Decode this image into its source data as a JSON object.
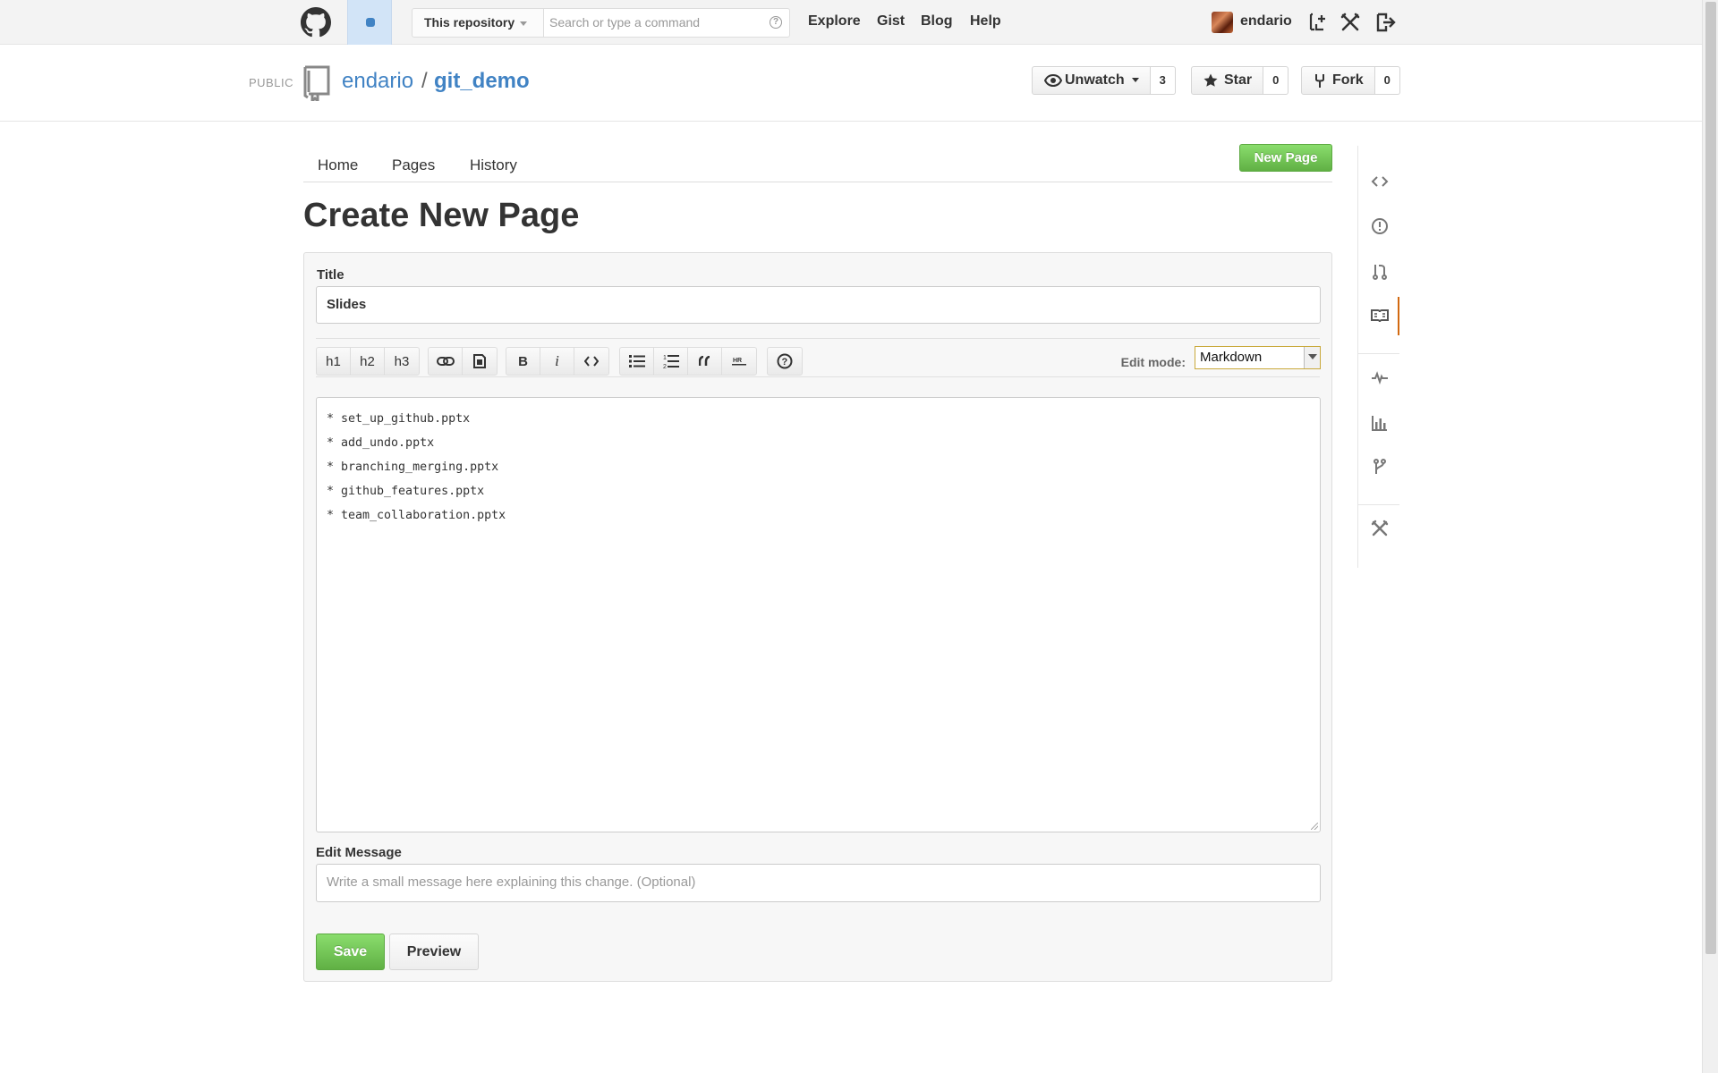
{
  "header": {
    "search_scope": "This repository",
    "search_placeholder": "Search or type a command",
    "nav": [
      "Explore",
      "Gist",
      "Blog",
      "Help"
    ],
    "username": "endario",
    "icons": [
      "github-octocat-icon",
      "notification-icon",
      "search-help-icon",
      "create-repo-icon",
      "settings-icon",
      "sign-out-icon"
    ]
  },
  "repo": {
    "visibility": "PUBLIC",
    "owner": "endario",
    "separator": "/",
    "name": "git_demo",
    "unwatch_label": "Unwatch",
    "watch_count": "3",
    "star_label": "Star",
    "star_count": "0",
    "fork_label": "Fork",
    "fork_count": "0"
  },
  "wiki_nav": {
    "items": [
      "Home",
      "Pages",
      "History"
    ],
    "new_page": "New Page"
  },
  "page": {
    "title": "Create New Page"
  },
  "form": {
    "title_label": "Title",
    "title_value": "Slides",
    "toolbar": {
      "headers": [
        "h1",
        "h2",
        "h3"
      ],
      "bold": "B",
      "italic": "i",
      "icons": [
        "link-icon",
        "image-icon",
        "code-icon",
        "bulleted-list-icon",
        "numbered-list-icon",
        "blockquote-icon",
        "horizontal-rule-icon",
        "help-icon"
      ]
    },
    "edit_mode_label": "Edit mode:",
    "edit_mode_value": "Markdown",
    "content_lines": [
      "* set_up_github.pptx",
      "* add_undo.pptx",
      "* branching_merging.pptx",
      "* github_features.pptx",
      "* team_collaboration.pptx"
    ],
    "message_label": "Edit Message",
    "message_placeholder": "Write a small message here explaining this change. (Optional)",
    "save": "Save",
    "preview": "Preview"
  },
  "sidebar_icons": [
    "code-icon",
    "issues-icon",
    "pull-requests-icon",
    "wiki-icon",
    "pulse-icon",
    "graphs-icon",
    "network-icon",
    "settings-icon"
  ],
  "colors": {
    "link": "#4183c4",
    "green": "#60b044",
    "active_tab": "#d26911"
  }
}
